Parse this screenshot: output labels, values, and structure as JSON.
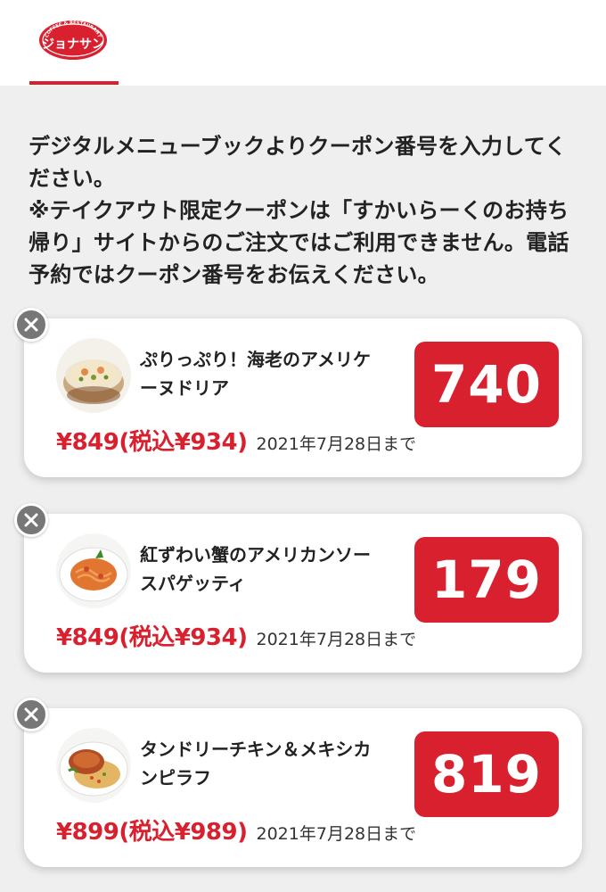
{
  "header": {
    "logo_top_text": "COFFEE & RESTAURANT",
    "logo_main_text": "ジョナサン"
  },
  "intro": {
    "line1": "デジタルメニューブックよりクーポン番号を入力してく",
    "line2": "ださい。",
    "line3": "※テイクアウト限定クーポンは「すかいらーくのお持ち",
    "line4": "帰り」サイトからのご注文ではご利用できません。電話",
    "line5": "予約ではクーポン番号をお伝えください。"
  },
  "coupons": [
    {
      "name_line1": "ぷりっぷり！海老のアメリケ",
      "name_line2": "ーヌドリア",
      "code": "740",
      "price": "¥849(税込¥934)",
      "expiry": "2021年7月28日まで",
      "thumb_icon": "gratin-dish-icon"
    },
    {
      "name_line1": "紅ずわい蟹のアメリカンソー",
      "name_line2": "スパゲッティ",
      "code": "179",
      "price": "¥849(税込¥934)",
      "expiry": "2021年7月28日まで",
      "thumb_icon": "spaghetti-plate-icon"
    },
    {
      "name_line1": "タンドリーチキン＆メキシカ",
      "name_line2": "ンピラフ",
      "code": "819",
      "price": "¥899(税込¥989)",
      "expiry": "2021年7月28日まで",
      "thumb_icon": "chicken-pilaf-plate-icon"
    }
  ],
  "colors": {
    "brand_red": "#d9202e",
    "background": "#efefef",
    "card": "#ffffff",
    "close_button": "#777777"
  }
}
